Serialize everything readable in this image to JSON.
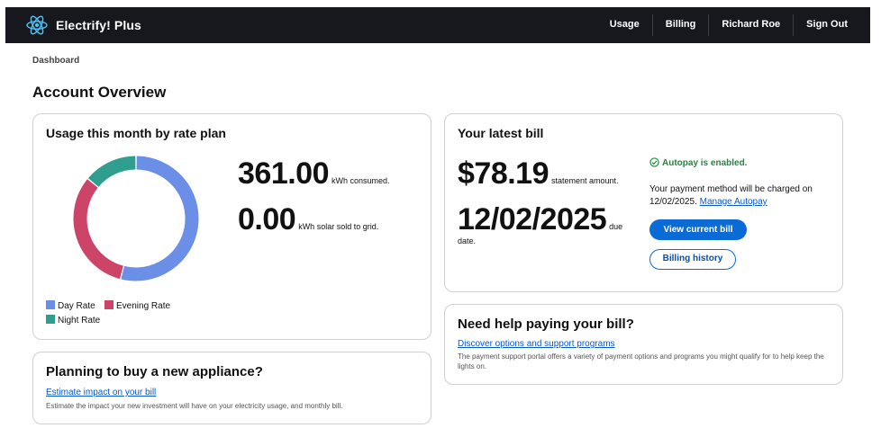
{
  "app": {
    "title": "Electrify! Plus"
  },
  "nav": {
    "items": [
      "Usage",
      "Billing",
      "Richard Roe",
      "Sign Out"
    ]
  },
  "breadcrumb": "Dashboard",
  "page_title": "Account Overview",
  "usage_card": {
    "title": "Usage this month by rate plan",
    "consumed_value": "361.00",
    "consumed_unit": "kWh consumed.",
    "solar_value": "0.00",
    "solar_unit": "kWh solar sold to grid.",
    "legend": [
      {
        "label": "Day Rate",
        "color": "#6b8fe6"
      },
      {
        "label": "Evening Rate",
        "color": "#cc4468"
      },
      {
        "label": "Night Rate",
        "color": "#2f9e8f"
      }
    ],
    "chart_data": {
      "type": "pie",
      "categories": [
        "Day Rate",
        "Evening Rate",
        "Night Rate"
      ],
      "values": [
        54,
        32,
        14
      ]
    }
  },
  "bill_card": {
    "title": "Your latest bill",
    "amount": "$78.19",
    "amount_label": "statement amount.",
    "due_date": "12/02/2025",
    "due_label_1": "due",
    "due_label_2": "date.",
    "autopay_status": "Autopay is enabled.",
    "autopay_msg": "Your payment method will be charged on 12/02/2025.",
    "manage_autopay": "Manage Autopay",
    "view_bill_btn": "View current bill",
    "billing_history_btn": "Billing history"
  },
  "appliance_card": {
    "title": "Planning to buy a new appliance?",
    "link": "Estimate impact on your bill",
    "desc": "Estimate the impact your new investment will have on your electricity usage, and monthly bill."
  },
  "help_card": {
    "title": "Need help paying your bill?",
    "link": "Discover options and support programs",
    "desc": "The payment support portal offers a variety of payment options and programs you might qualify for to help keep the lights on."
  },
  "colors": {
    "header_bg": "#16181d",
    "accent": "#0b6bd6",
    "success": "#1e8a3c"
  }
}
